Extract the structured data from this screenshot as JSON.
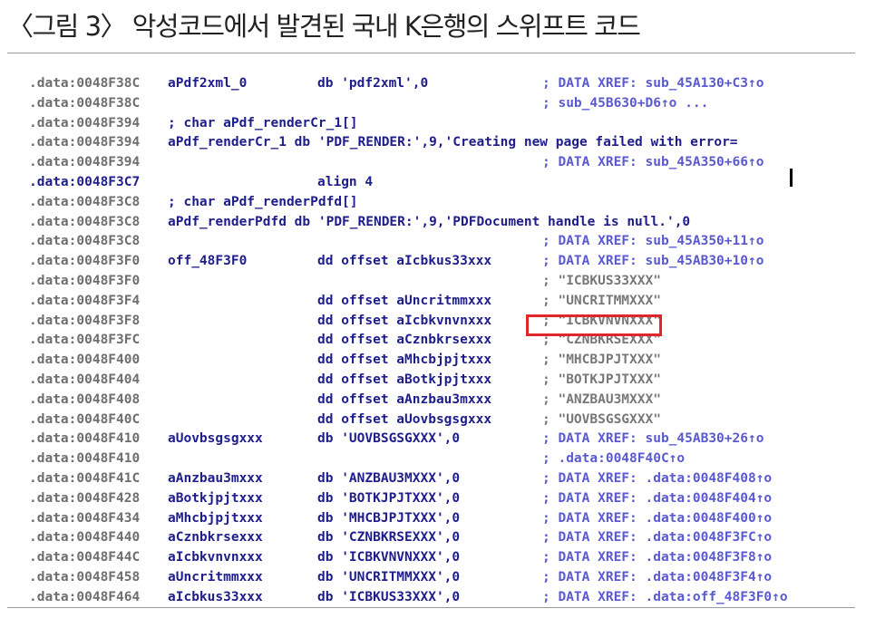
{
  "caption": "〈그림 3〉 악성코드에서 발견된 국내 K은행의 스위프트 코드",
  "rows": [
    {
      "addr": ".data:0048F38C",
      "label": "aPdf2xml_0",
      "code": "db 'pdf2xml',0",
      "comment": "; DATA XREF: sub_45A130+C3↑o"
    },
    {
      "addr": ".data:0048F38C",
      "label": "",
      "code": "",
      "comment": "; sub_45B630+D6↑o ..."
    },
    {
      "addr": ".data:0048F394",
      "label": "; char aPdf_renderCr_1[]",
      "code": "",
      "comment": ""
    },
    {
      "addr": ".data:0048F394",
      "label": "aPdf_renderCr_1 db 'PDF_RENDER:',9,'Creating new page failed with error=",
      "code": "",
      "comment": ""
    },
    {
      "addr": ".data:0048F394",
      "label": "",
      "code": "",
      "comment": "; DATA XREF: sub_45A350+66↑o"
    },
    {
      "addr": ".data:0048F3C7",
      "label": "",
      "code": "align 4",
      "comment": ""
    },
    {
      "addr": ".data:0048F3C8",
      "label": "; char aPdf_renderPdfd[]",
      "code": "",
      "comment": ""
    },
    {
      "addr": ".data:0048F3C8",
      "label": "aPdf_renderPdfd db 'PDF_RENDER:',9,'PDFDocument handle is null.',0",
      "code": "",
      "comment": ""
    },
    {
      "addr": ".data:0048F3C8",
      "label": "",
      "code": "",
      "comment": "; DATA XREF: sub_45A350+11↑o"
    },
    {
      "addr": ".data:0048F3F0",
      "label": "off_48F3F0",
      "code": "dd offset aIcbkus33xxx",
      "comment": "; DATA XREF: sub_45AB30+10↑o"
    },
    {
      "addr": ".data:0048F3F0",
      "label": "",
      "code": "",
      "comment": "; \"ICBKUS33XXX\""
    },
    {
      "addr": ".data:0048F3F4",
      "label": "",
      "code": "dd offset aUncritmmxxx",
      "comment": "; \"UNCRITMMXXX\""
    },
    {
      "addr": ".data:0048F3F8",
      "label": "",
      "code": "dd offset aIcbkvnvnxxx",
      "comment": "; \"ICBKVNVNXXX\""
    },
    {
      "addr": ".data:0048F3FC",
      "label": "",
      "code": "dd offset aCznbkrsexxx",
      "comment": "; \"CZNBKRSEXXX\""
    },
    {
      "addr": ".data:0048F400",
      "label": "",
      "code": "dd offset aMhcbjpjtxxx",
      "comment": "; \"MHCBJPJTXXX\""
    },
    {
      "addr": ".data:0048F404",
      "label": "",
      "code": "dd offset aBotkjpjtxxx",
      "comment": "; \"BOTKJPJTXXX\""
    },
    {
      "addr": ".data:0048F408",
      "label": "",
      "code": "dd offset aAnzbau3mxxx",
      "comment": "; \"ANZBAU3MXXX\""
    },
    {
      "addr": ".data:0048F40C",
      "label": "",
      "code": "dd offset aUovbsgsgxxx",
      "comment": "; \"UOVBSGSGXXX\""
    },
    {
      "addr": ".data:0048F410",
      "label": "aUovbsgsgxxx",
      "code": "db 'UOVBSGSGXXX',0",
      "comment": "; DATA XREF: sub_45AB30+26↑o"
    },
    {
      "addr": ".data:0048F410",
      "label": "",
      "code": "",
      "comment": "; .data:0048F40C↑o"
    },
    {
      "addr": ".data:0048F41C",
      "label": "aAnzbau3mxxx",
      "code": "db 'ANZBAU3MXXX',0",
      "comment": "; DATA XREF: .data:0048F408↑o"
    },
    {
      "addr": ".data:0048F428",
      "label": "aBotkjpjtxxx",
      "code": "db 'BOTKJPJTXXX',0",
      "comment": "; DATA XREF: .data:0048F404↑o"
    },
    {
      "addr": ".data:0048F434",
      "label": "aMhcbjpjtxxx",
      "code": "db 'MHCBJPJTXXX',0",
      "comment": "; DATA XREF: .data:0048F400↑o"
    },
    {
      "addr": ".data:0048F440",
      "label": "aCznbkrsexxx",
      "code": "db 'CZNBKRSEXXX',0",
      "comment": "; DATA XREF: .data:0048F3FC↑o"
    },
    {
      "addr": ".data:0048F44C",
      "label": "aIcbkvnvnxxx",
      "code": "db 'ICBKVNVNXXX',0",
      "comment": "; DATA XREF: .data:0048F3F8↑o"
    },
    {
      "addr": ".data:0048F458",
      "label": "aUncritmmxxx",
      "code": "db 'UNCRITMMXXX',0",
      "comment": "; DATA XREF: .data:0048F3F4↑o"
    },
    {
      "addr": ".data:0048F464",
      "label": "aIcbkus33xxx",
      "code": "db 'ICBKUS33XXX',0",
      "comment": "; DATA XREF: .data:off_48F3F0↑o"
    }
  ],
  "colors": {
    "address": "#6e6e6e",
    "label": "#1d1d8c",
    "string": "#1f7a1f",
    "comment": "#5a5ad0",
    "highlight_box": "#e0262a"
  },
  "highlighted_comment_row": 13
}
